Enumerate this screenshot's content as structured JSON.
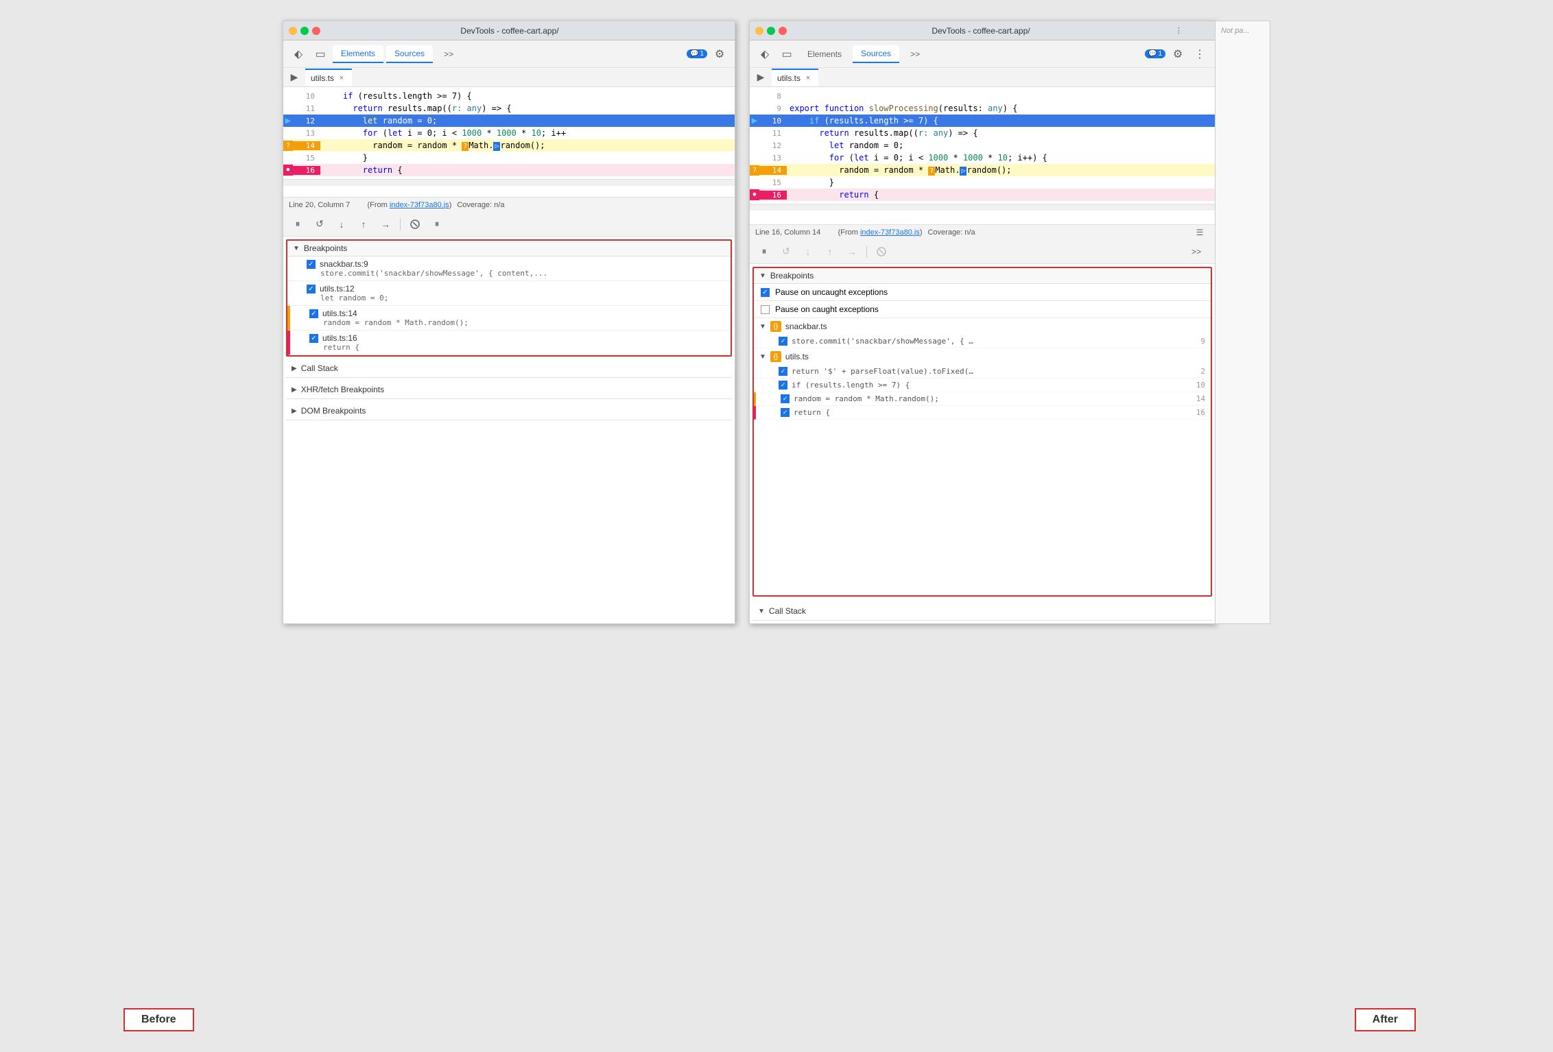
{
  "window_title": "DevTools - coffee-cart.app/",
  "tabs": {
    "elements": "Elements",
    "sources": "Sources",
    "more": ">>"
  },
  "file_tab": {
    "name": "utils.ts",
    "close": "×"
  },
  "notification": {
    "icon": "💬",
    "count": "1"
  },
  "before": {
    "label": "Before",
    "status_bar": {
      "line_col": "Line 20, Column 7",
      "from_label": "(From ",
      "from_file": "index-73f73a80.js",
      "from_end": ")",
      "coverage": "Coverage: n/a"
    },
    "code_lines": [
      {
        "num": "10",
        "content": "    if (results.length >= 7) {",
        "type": "normal"
      },
      {
        "num": "11",
        "content": "      return results.map((r: any) => {",
        "type": "normal"
      },
      {
        "num": "12",
        "content": "        let random = 0;",
        "type": "current"
      },
      {
        "num": "13",
        "content": "        for (let i = 0; i < 1000 * 1000 * 10; i++",
        "type": "normal"
      },
      {
        "num": "14",
        "content": "          random = random * ❓Math.▷random();",
        "type": "breakpoint-q"
      },
      {
        "num": "15",
        "content": "        }",
        "type": "normal"
      },
      {
        "num": "16",
        "content": "        return {",
        "type": "breakpoint-pink"
      }
    ],
    "breakpoints_section": "Breakpoints",
    "breakpoints": [
      {
        "file": "snackbar.ts:9",
        "code": "store.commit('snackbar/showMessage', { content,..."
      },
      {
        "file": "utils.ts:12",
        "code": "let random = 0;"
      },
      {
        "file": "utils.ts:14",
        "code": "random = random * Math.random();"
      },
      {
        "file": "utils.ts:16",
        "code": "return {"
      }
    ],
    "call_stack": "Call Stack",
    "xhr_breakpoints": "XHR/fetch Breakpoints",
    "dom_breakpoints": "DOM Breakpoints"
  },
  "after": {
    "label": "After",
    "status_bar": {
      "line_col": "Line 16, Column 14",
      "from_label": "(From ",
      "from_file": "index-73f73a80.js",
      "from_end": ")",
      "coverage": "Coverage: n/a"
    },
    "code_lines": [
      {
        "num": "8",
        "content": "",
        "type": "normal"
      },
      {
        "num": "9",
        "content": "export function slowProcessing(results: any) {",
        "type": "normal"
      },
      {
        "num": "10",
        "content": "    if (results.length >= 7) {",
        "type": "current"
      },
      {
        "num": "11",
        "content": "      return results.map((r: any) => {",
        "type": "normal"
      },
      {
        "num": "12",
        "content": "        let random = 0;",
        "type": "normal"
      },
      {
        "num": "13",
        "content": "        for (let i = 0; i < 1000 * 1000 * 10; i++) {",
        "type": "normal"
      },
      {
        "num": "14",
        "content": "          random = random * ❓Math.▷random();",
        "type": "breakpoint-q"
      },
      {
        "num": "15",
        "content": "        }",
        "type": "normal"
      },
      {
        "num": "16",
        "content": "        return {",
        "type": "breakpoint-pink"
      }
    ],
    "breakpoints_section": "Breakpoints",
    "pause_uncaught": "Pause on uncaught exceptions",
    "pause_caught": "Pause on caught exceptions",
    "bp_groups": [
      {
        "file": "snackbar.ts",
        "items": [
          {
            "code": "store.commit('snackbar/showMessage', { …",
            "line": "9"
          }
        ]
      },
      {
        "file": "utils.ts",
        "items": [
          {
            "code": "return '$' + parseFloat(value).toFixed(…",
            "line": "2"
          },
          {
            "code": "if (results.length >= 7) {",
            "line": "10"
          },
          {
            "code": "random = random * Math.random();",
            "line": "14"
          },
          {
            "code": "return {",
            "line": "16"
          }
        ]
      }
    ],
    "call_stack": "Call Stack",
    "not_paused": "Not pa..."
  }
}
